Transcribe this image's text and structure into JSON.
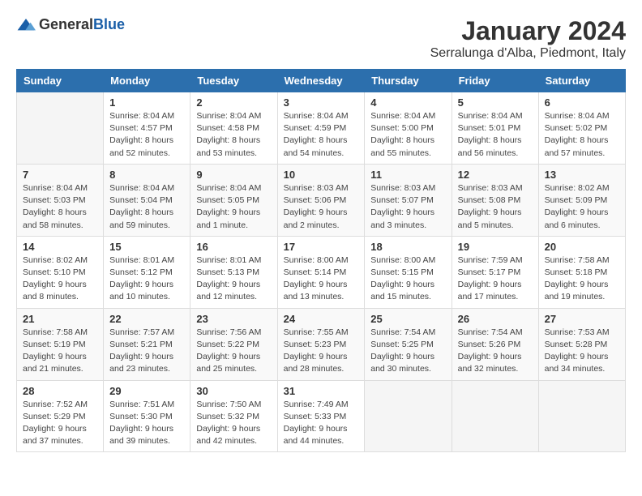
{
  "logo": {
    "general": "General",
    "blue": "Blue"
  },
  "title": "January 2024",
  "location": "Serralunga d'Alba, Piedmont, Italy",
  "headers": [
    "Sunday",
    "Monday",
    "Tuesday",
    "Wednesday",
    "Thursday",
    "Friday",
    "Saturday"
  ],
  "weeks": [
    [
      {
        "day": "",
        "info": ""
      },
      {
        "day": "1",
        "info": "Sunrise: 8:04 AM\nSunset: 4:57 PM\nDaylight: 8 hours\nand 52 minutes."
      },
      {
        "day": "2",
        "info": "Sunrise: 8:04 AM\nSunset: 4:58 PM\nDaylight: 8 hours\nand 53 minutes."
      },
      {
        "day": "3",
        "info": "Sunrise: 8:04 AM\nSunset: 4:59 PM\nDaylight: 8 hours\nand 54 minutes."
      },
      {
        "day": "4",
        "info": "Sunrise: 8:04 AM\nSunset: 5:00 PM\nDaylight: 8 hours\nand 55 minutes."
      },
      {
        "day": "5",
        "info": "Sunrise: 8:04 AM\nSunset: 5:01 PM\nDaylight: 8 hours\nand 56 minutes."
      },
      {
        "day": "6",
        "info": "Sunrise: 8:04 AM\nSunset: 5:02 PM\nDaylight: 8 hours\nand 57 minutes."
      }
    ],
    [
      {
        "day": "7",
        "info": "Sunrise: 8:04 AM\nSunset: 5:03 PM\nDaylight: 8 hours\nand 58 minutes."
      },
      {
        "day": "8",
        "info": "Sunrise: 8:04 AM\nSunset: 5:04 PM\nDaylight: 8 hours\nand 59 minutes."
      },
      {
        "day": "9",
        "info": "Sunrise: 8:04 AM\nSunset: 5:05 PM\nDaylight: 9 hours\nand 1 minute."
      },
      {
        "day": "10",
        "info": "Sunrise: 8:03 AM\nSunset: 5:06 PM\nDaylight: 9 hours\nand 2 minutes."
      },
      {
        "day": "11",
        "info": "Sunrise: 8:03 AM\nSunset: 5:07 PM\nDaylight: 9 hours\nand 3 minutes."
      },
      {
        "day": "12",
        "info": "Sunrise: 8:03 AM\nSunset: 5:08 PM\nDaylight: 9 hours\nand 5 minutes."
      },
      {
        "day": "13",
        "info": "Sunrise: 8:02 AM\nSunset: 5:09 PM\nDaylight: 9 hours\nand 6 minutes."
      }
    ],
    [
      {
        "day": "14",
        "info": "Sunrise: 8:02 AM\nSunset: 5:10 PM\nDaylight: 9 hours\nand 8 minutes."
      },
      {
        "day": "15",
        "info": "Sunrise: 8:01 AM\nSunset: 5:12 PM\nDaylight: 9 hours\nand 10 minutes."
      },
      {
        "day": "16",
        "info": "Sunrise: 8:01 AM\nSunset: 5:13 PM\nDaylight: 9 hours\nand 12 minutes."
      },
      {
        "day": "17",
        "info": "Sunrise: 8:00 AM\nSunset: 5:14 PM\nDaylight: 9 hours\nand 13 minutes."
      },
      {
        "day": "18",
        "info": "Sunrise: 8:00 AM\nSunset: 5:15 PM\nDaylight: 9 hours\nand 15 minutes."
      },
      {
        "day": "19",
        "info": "Sunrise: 7:59 AM\nSunset: 5:17 PM\nDaylight: 9 hours\nand 17 minutes."
      },
      {
        "day": "20",
        "info": "Sunrise: 7:58 AM\nSunset: 5:18 PM\nDaylight: 9 hours\nand 19 minutes."
      }
    ],
    [
      {
        "day": "21",
        "info": "Sunrise: 7:58 AM\nSunset: 5:19 PM\nDaylight: 9 hours\nand 21 minutes."
      },
      {
        "day": "22",
        "info": "Sunrise: 7:57 AM\nSunset: 5:21 PM\nDaylight: 9 hours\nand 23 minutes."
      },
      {
        "day": "23",
        "info": "Sunrise: 7:56 AM\nSunset: 5:22 PM\nDaylight: 9 hours\nand 25 minutes."
      },
      {
        "day": "24",
        "info": "Sunrise: 7:55 AM\nSunset: 5:23 PM\nDaylight: 9 hours\nand 28 minutes."
      },
      {
        "day": "25",
        "info": "Sunrise: 7:54 AM\nSunset: 5:25 PM\nDaylight: 9 hours\nand 30 minutes."
      },
      {
        "day": "26",
        "info": "Sunrise: 7:54 AM\nSunset: 5:26 PM\nDaylight: 9 hours\nand 32 minutes."
      },
      {
        "day": "27",
        "info": "Sunrise: 7:53 AM\nSunset: 5:28 PM\nDaylight: 9 hours\nand 34 minutes."
      }
    ],
    [
      {
        "day": "28",
        "info": "Sunrise: 7:52 AM\nSunset: 5:29 PM\nDaylight: 9 hours\nand 37 minutes."
      },
      {
        "day": "29",
        "info": "Sunrise: 7:51 AM\nSunset: 5:30 PM\nDaylight: 9 hours\nand 39 minutes."
      },
      {
        "day": "30",
        "info": "Sunrise: 7:50 AM\nSunset: 5:32 PM\nDaylight: 9 hours\nand 42 minutes."
      },
      {
        "day": "31",
        "info": "Sunrise: 7:49 AM\nSunset: 5:33 PM\nDaylight: 9 hours\nand 44 minutes."
      },
      {
        "day": "",
        "info": ""
      },
      {
        "day": "",
        "info": ""
      },
      {
        "day": "",
        "info": ""
      }
    ]
  ]
}
